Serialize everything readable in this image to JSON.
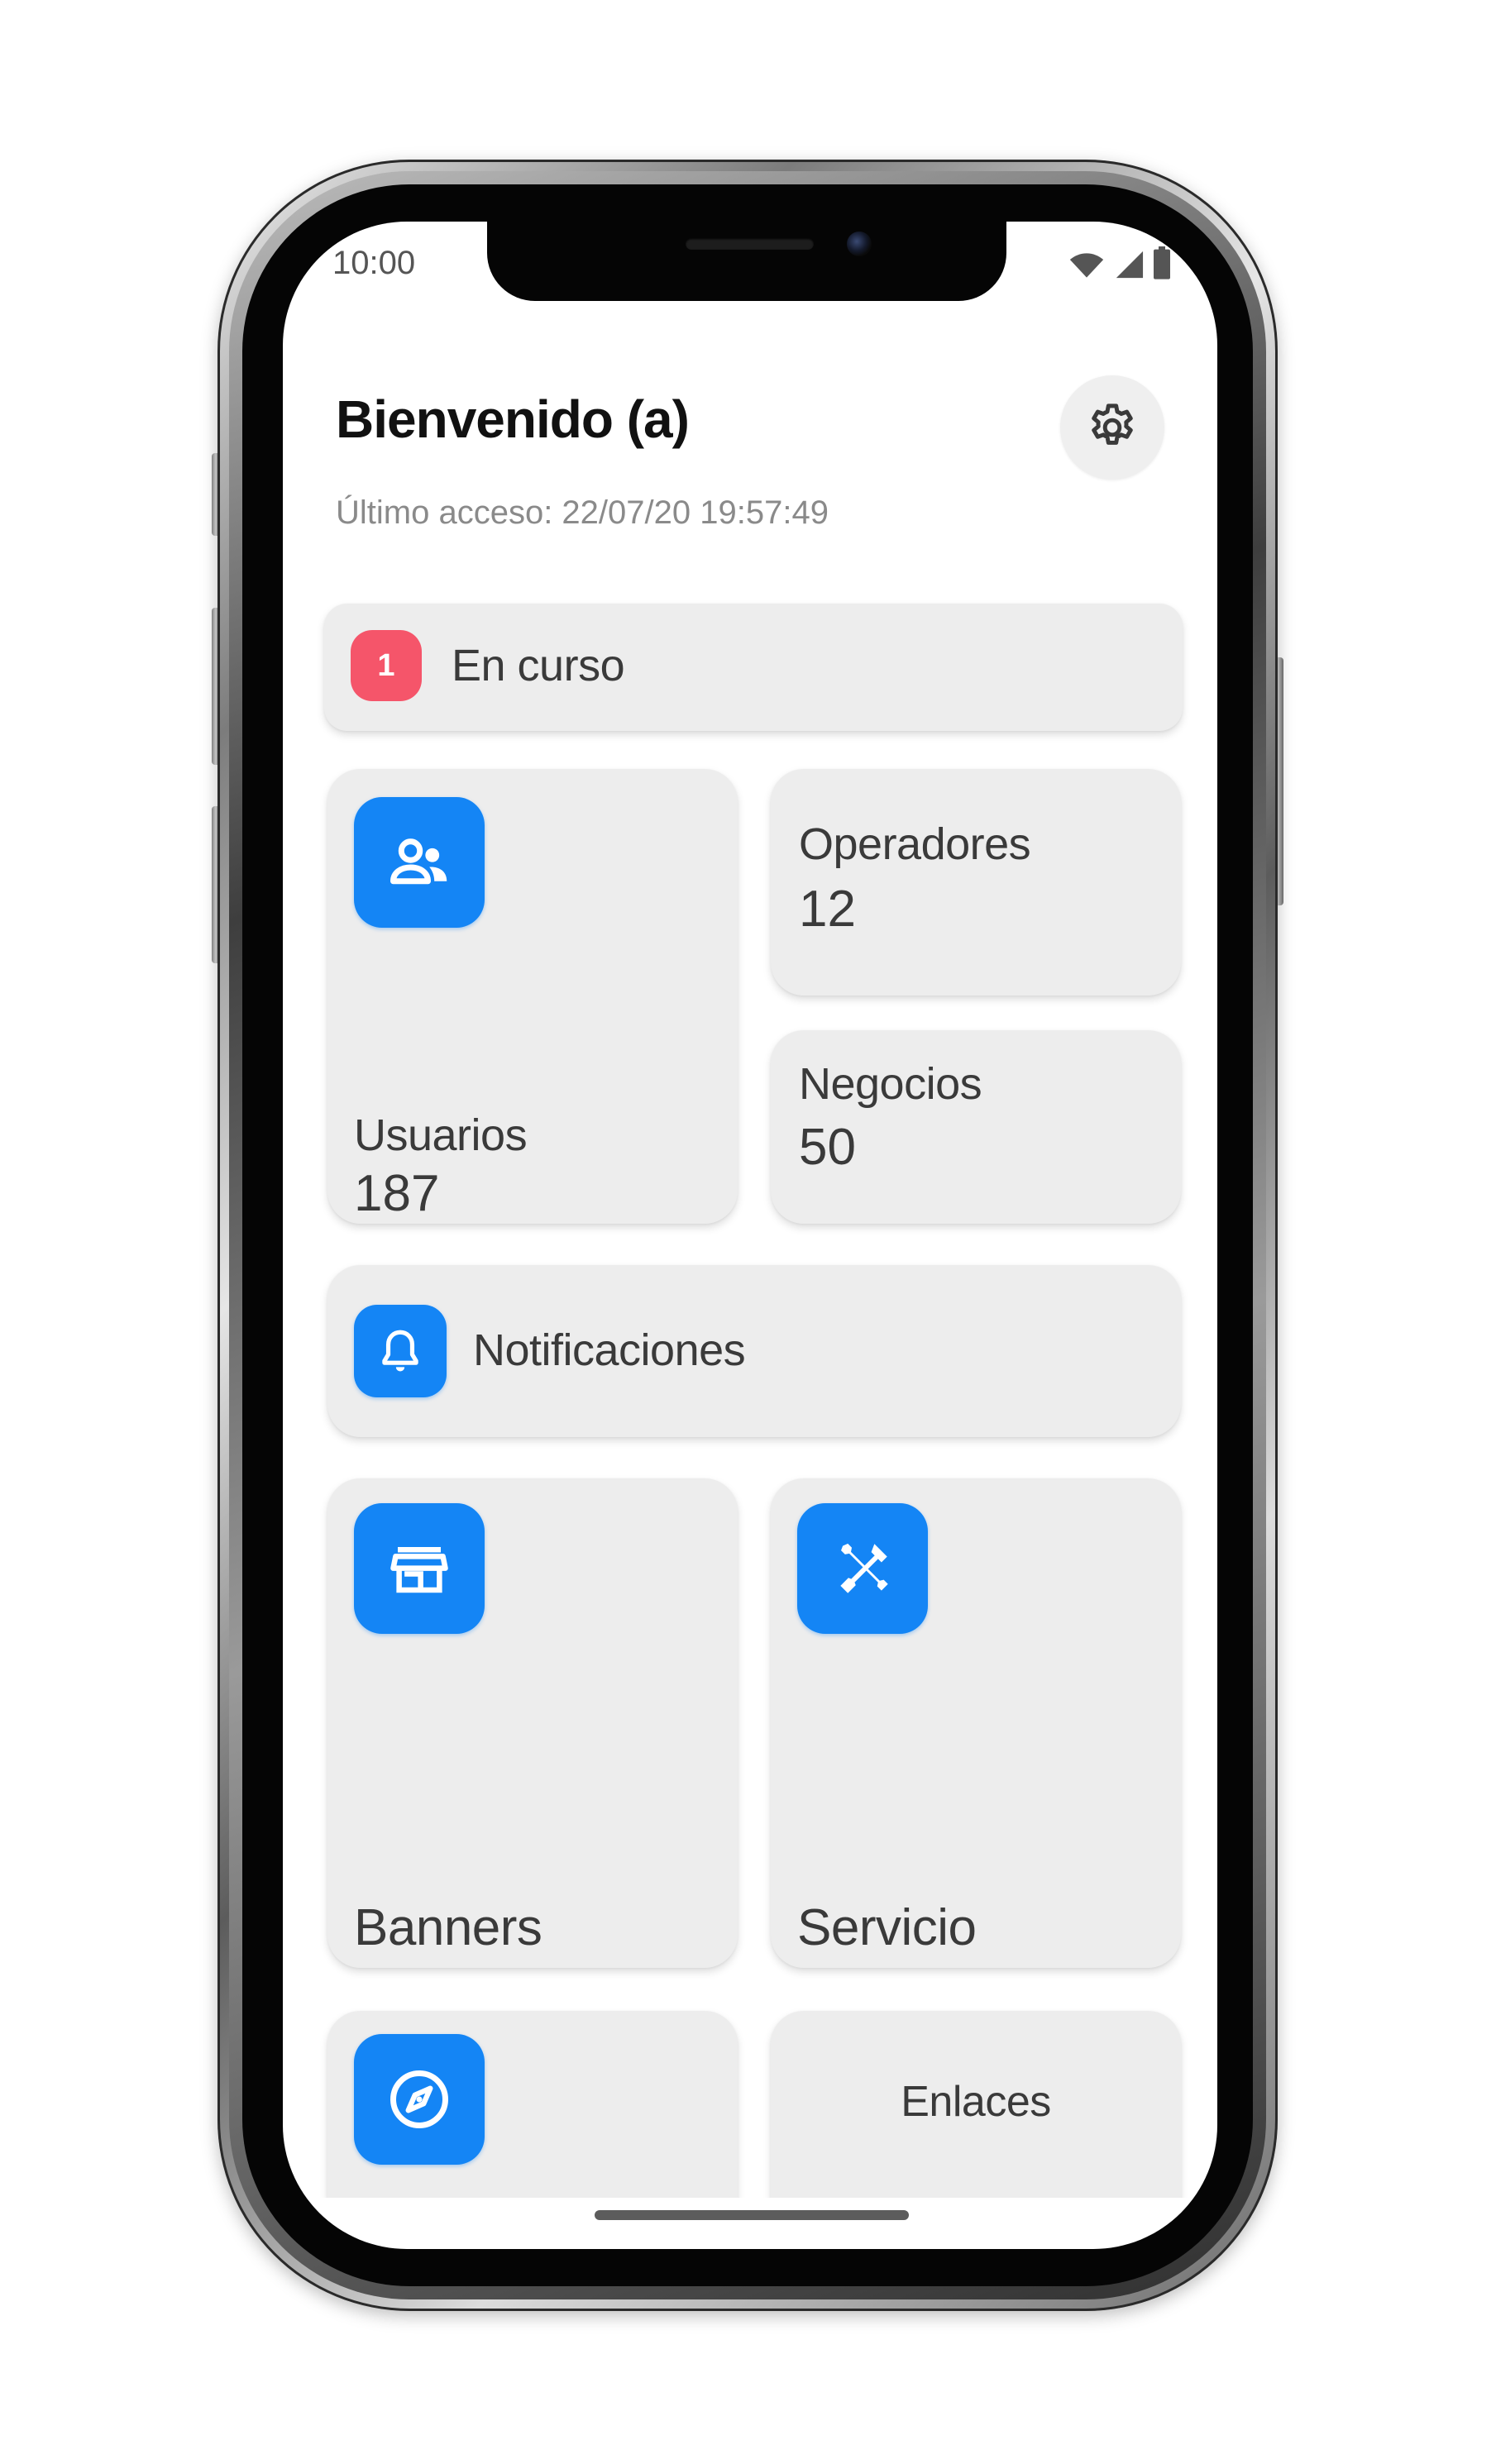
{
  "status_bar": {
    "time": "10:00"
  },
  "header": {
    "title": "Bienvenido (a)",
    "last_access": "Último acceso: 22/07/20 19:57:49",
    "settings_icon": "gear-icon"
  },
  "in_progress": {
    "count": "1",
    "label": "En curso",
    "badge_color": "#f5556a"
  },
  "stats": {
    "users": {
      "label": "Usuarios",
      "value": "187",
      "icon": "users-icon"
    },
    "operators": {
      "label": "Operadores",
      "value": "12"
    },
    "businesses": {
      "label": "Negocios",
      "value": "50"
    }
  },
  "notifications": {
    "label": "Notificaciones",
    "icon": "bell-icon"
  },
  "tiles": {
    "banners": {
      "label": "Banners",
      "icon": "store-icon"
    },
    "service": {
      "label": "Servicio",
      "icon": "tools-icon"
    },
    "explore": {
      "label": "",
      "icon": "compass-icon"
    },
    "links": {
      "label": "Enlaces"
    }
  },
  "colors": {
    "accent": "#1485f5",
    "card_bg": "#ededed",
    "text_primary": "#111111",
    "text_secondary": "#8a8a8a"
  }
}
